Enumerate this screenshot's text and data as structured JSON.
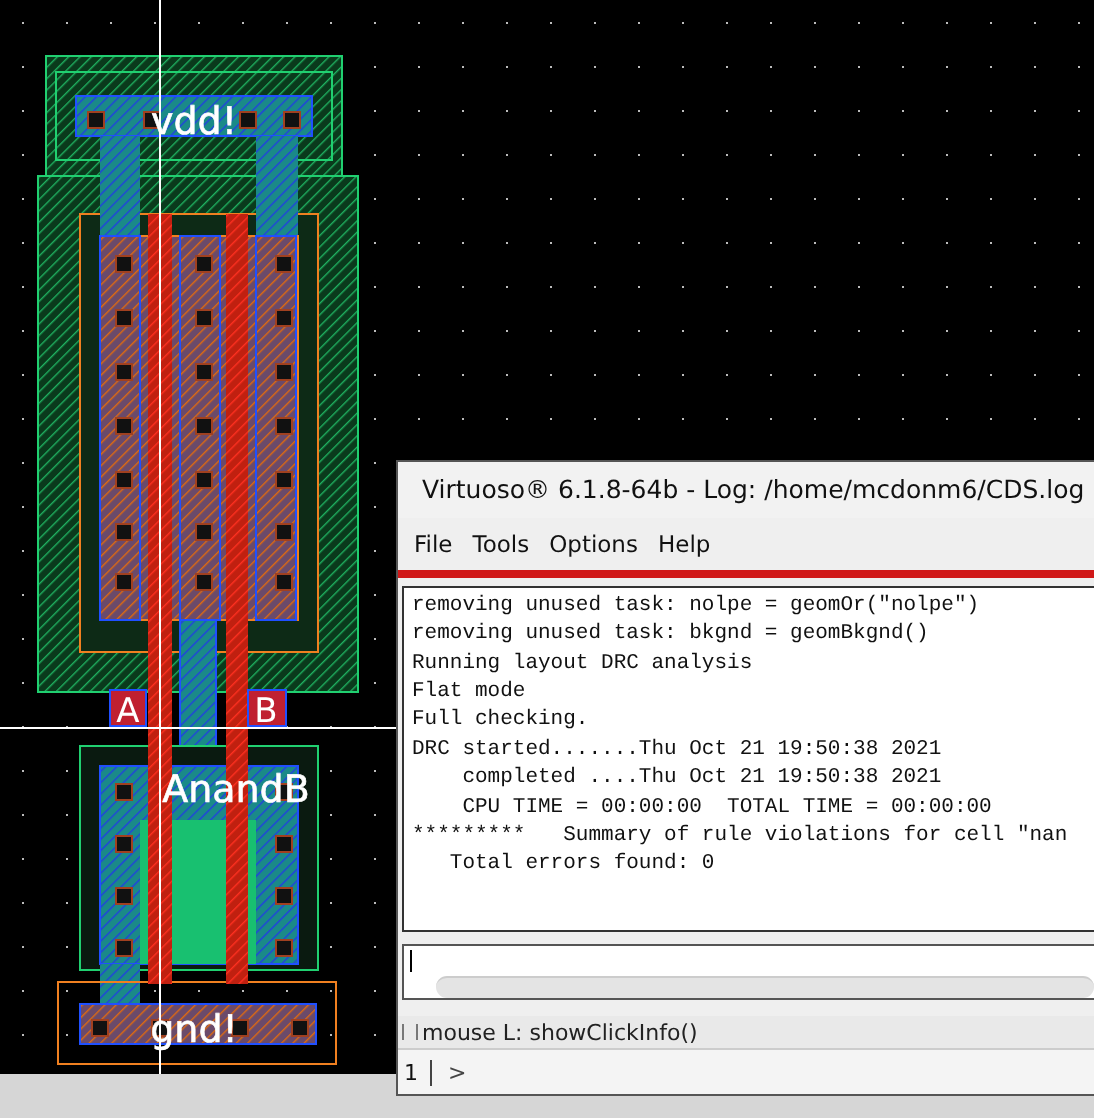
{
  "layout": {
    "labels": [
      {
        "text": "vdd!",
        "kind": "net"
      },
      {
        "text": "A",
        "kind": "pin"
      },
      {
        "text": "B",
        "kind": "pin"
      },
      {
        "text": "AnandB",
        "kind": "net"
      },
      {
        "text": "gnd!",
        "kind": "net"
      }
    ]
  },
  "log_window": {
    "title": "Virtuoso® 6.1.8-64b - Log: /home/mcdonm6/CDS.log",
    "menu": [
      "File",
      "Tools",
      "Options",
      "Help"
    ],
    "log_lines": [
      "removing unused task: nolpe = geomOr(\"nolpe\")",
      "removing unused task: bkgnd = geomBkgnd()",
      "Running layout DRC analysis",
      "Flat mode",
      "Full checking.",
      "DRC started.......Thu Oct 21 19:50:38 2021",
      "    completed ....Thu Oct 21 19:50:38 2021",
      "    CPU TIME = 00:00:00  TOTAL TIME = 00:00:00",
      "*********   Summary of rule violations for cell \"nan",
      "   Total errors found: 0"
    ],
    "status": "mouse L: showClickInfo()",
    "prompt_number": "1",
    "prompt": ">"
  }
}
